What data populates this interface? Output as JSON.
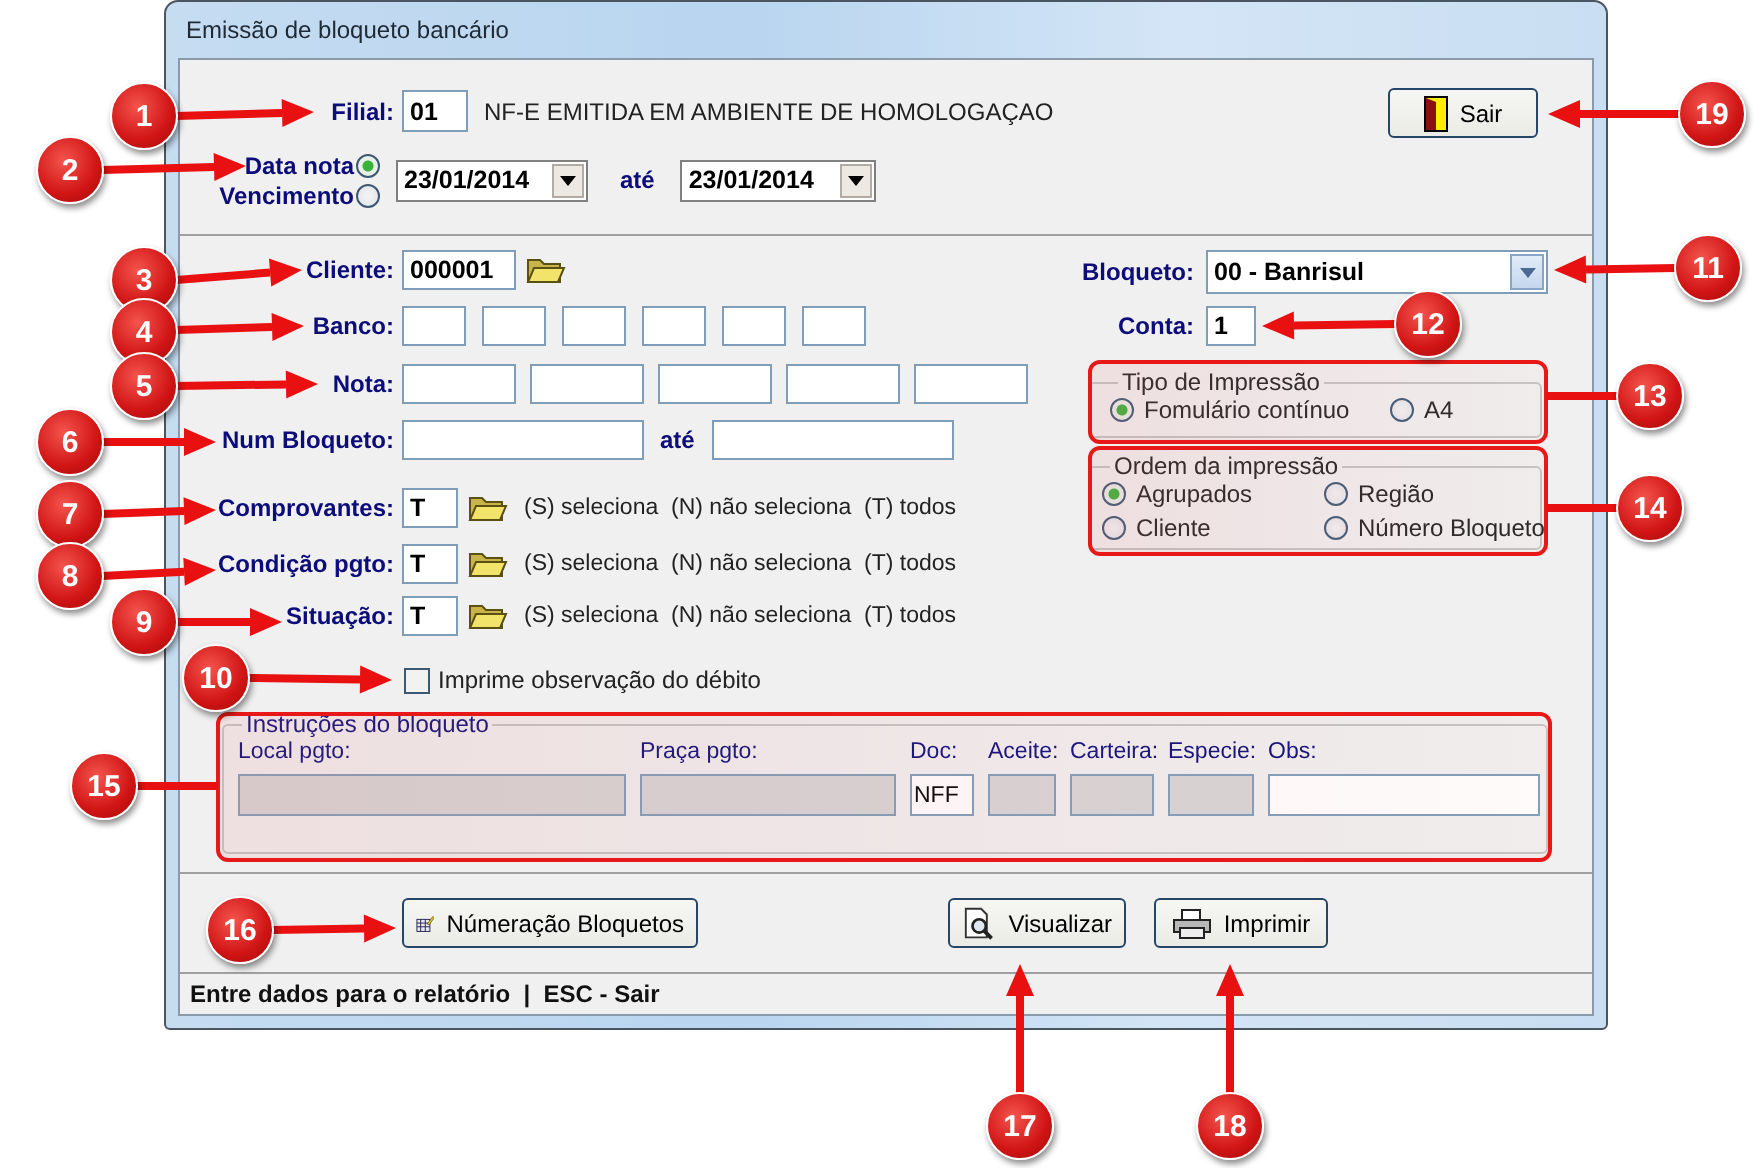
{
  "window": {
    "title": "Emissão de bloqueto bancário"
  },
  "filial": {
    "label": "Filial:",
    "value": "01",
    "description": "NF-E EMITIDA EM AMBIENTE DE HOMOLOGAÇAO"
  },
  "date_filter": {
    "options": [
      {
        "label": "Data nota",
        "selected": true
      },
      {
        "label": "Vencimento",
        "selected": false
      }
    ],
    "from": "23/01/2014",
    "to_label": "até",
    "to": "23/01/2014"
  },
  "exit_button": {
    "label": "Sair"
  },
  "cliente": {
    "label": "Cliente:",
    "value": "000001"
  },
  "banco": {
    "label": "Banco:"
  },
  "nota": {
    "label": "Nota:"
  },
  "num_bloqueto": {
    "label": "Num Bloqueto:",
    "to_label": "até"
  },
  "selectors": [
    {
      "label": "Comprovantes:",
      "value": "T",
      "hint": "(S) seleciona  (N) não seleciona  (T) todos"
    },
    {
      "label": "Condição pgto:",
      "value": "T",
      "hint": "(S) seleciona  (N) não seleciona  (T) todos"
    },
    {
      "label": "Situação:",
      "value": "T",
      "hint": "(S) seleciona  (N) não seleciona  (T) todos"
    }
  ],
  "print_observation": {
    "label": "Imprime observação do débito",
    "checked": false
  },
  "bloqueto": {
    "label": "Bloqueto:",
    "value": "00 - Banrisul"
  },
  "conta": {
    "label": "Conta:",
    "value": "1"
  },
  "print_type": {
    "title": "Tipo de Impressão",
    "options": [
      {
        "label": "Fomulário contínuo",
        "selected": true
      },
      {
        "label": "A4",
        "selected": false
      }
    ]
  },
  "print_order": {
    "title": "Ordem da impressão",
    "options": [
      {
        "label": "Agrupados",
        "selected": true
      },
      {
        "label": "Região",
        "selected": false
      },
      {
        "label": "Cliente",
        "selected": false
      },
      {
        "label": "Número Bloqueto",
        "selected": false
      }
    ]
  },
  "instructions": {
    "title": "Instruções do bloqueto",
    "fields": [
      {
        "label": "Local pgto:",
        "disabled": true
      },
      {
        "label": "Praça pgto:",
        "disabled": true
      },
      {
        "label": "Doc:",
        "value": "NFF",
        "disabled": false
      },
      {
        "label": "Aceite:",
        "disabled": true
      },
      {
        "label": "Carteira:",
        "disabled": true
      },
      {
        "label": "Especie:",
        "disabled": true
      },
      {
        "label": "Obs:",
        "disabled": false
      }
    ]
  },
  "buttons": [
    {
      "kind": "numbering",
      "label": "Númeração Bloquetos"
    },
    {
      "kind": "preview",
      "label": "Visualizar"
    },
    {
      "kind": "print",
      "label": "Imprimir"
    }
  ],
  "status_bar": "Entre dados para o relatório  |  ESC - Sair",
  "callouts": [
    {
      "number": "1"
    },
    {
      "number": "2"
    },
    {
      "number": "3"
    },
    {
      "number": "4"
    },
    {
      "number": "5"
    },
    {
      "number": "6"
    },
    {
      "number": "7"
    },
    {
      "number": "8"
    },
    {
      "number": "9"
    },
    {
      "number": "10"
    },
    {
      "number": "11"
    },
    {
      "number": "12"
    },
    {
      "number": "13"
    },
    {
      "number": "14"
    },
    {
      "number": "15"
    },
    {
      "number": "16"
    },
    {
      "number": "17"
    },
    {
      "number": "18"
    },
    {
      "number": "19"
    }
  ]
}
